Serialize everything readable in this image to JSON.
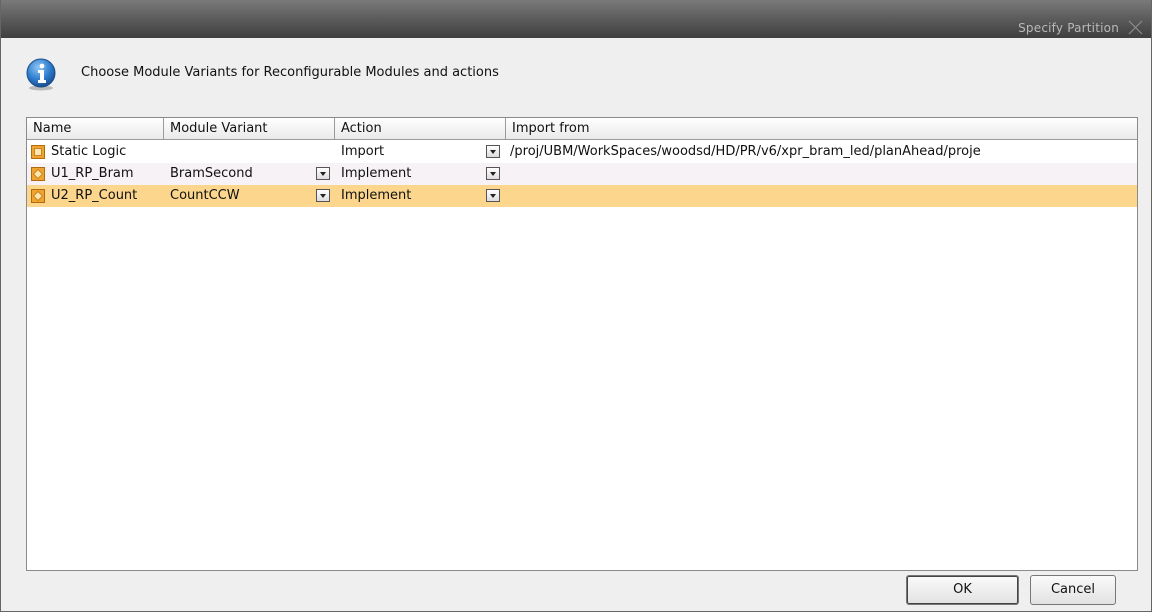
{
  "window": {
    "title": "Specify Partition"
  },
  "message": "Choose Module Variants for Reconfigurable Modules and actions",
  "table": {
    "columns": [
      "Name",
      "Module Variant",
      "Action",
      "Import from"
    ],
    "rows": [
      {
        "icon": "static-partition-icon",
        "name": "Static Logic",
        "variant": "",
        "action": "Import",
        "import_from": "/proj/UBM/WorkSpaces/woodsd/HD/PR/v6/xpr_bram_led/planAhead/proje"
      },
      {
        "icon": "reconfig-partition-icon",
        "name": "U1_RP_Bram",
        "variant": "BramSecond",
        "action": "Implement",
        "import_from": ""
      },
      {
        "icon": "reconfig-partition-icon",
        "name": "U2_RP_Count",
        "variant": "CountCCW",
        "action": "Implement",
        "import_from": ""
      }
    ],
    "selected_row_color": "#fdd68d"
  },
  "buttons": {
    "ok": "OK",
    "cancel": "Cancel"
  }
}
